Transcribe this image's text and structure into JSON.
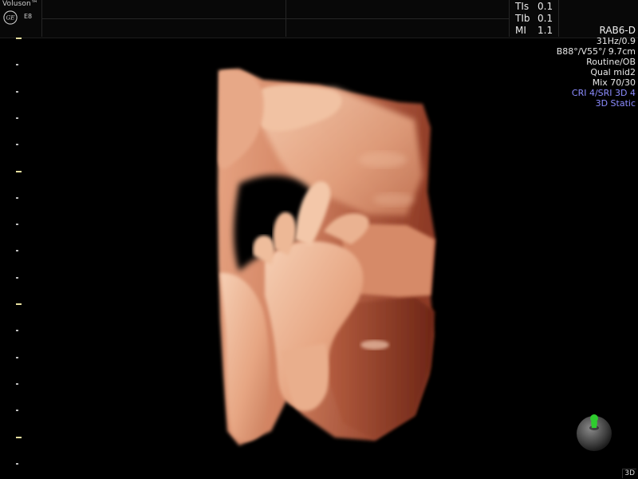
{
  "header": {
    "brand": "Voluson™",
    "model": "E8",
    "logo_text": "GE",
    "acoustic": [
      {
        "label": "TIs",
        "value": "0.1"
      },
      {
        "label": "TIb",
        "value": "0.1"
      },
      {
        "label": "MI",
        "value": "1.1"
      }
    ]
  },
  "params": [
    {
      "text": "RAB6-D",
      "style": "probe"
    },
    {
      "text": "31Hz/0.9",
      "style": "normal"
    },
    {
      "text": "B88°/V55°/ 9.7cm",
      "style": "normal"
    },
    {
      "text": "Routine/OB",
      "style": "normal"
    },
    {
      "text": "Qual mid2",
      "style": "normal"
    },
    {
      "text": "Mix 70/30",
      "style": "normal"
    },
    {
      "text": "CRI 4/SRI 3D 4",
      "style": "blue"
    },
    {
      "text": "3D Static",
      "style": "blue"
    }
  ],
  "render": {
    "mode": "3D",
    "palette": [
      "#f3c2a3",
      "#d98a67",
      "#b45a3e",
      "#7a2c1c"
    ],
    "marker_color": "#2ecc2e"
  }
}
